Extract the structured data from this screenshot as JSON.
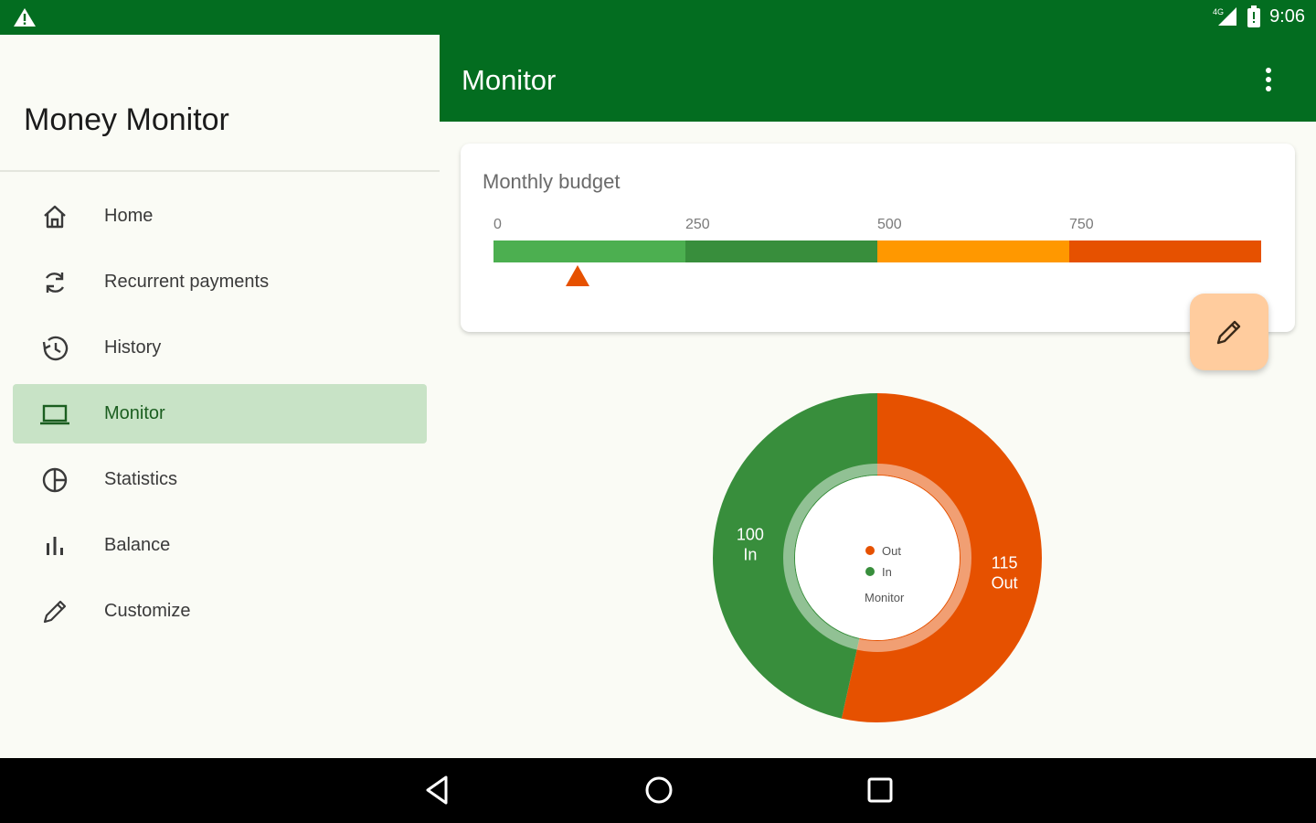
{
  "status_bar": {
    "network": "4G",
    "time": "9:06"
  },
  "drawer": {
    "title": "Money Monitor",
    "items": [
      {
        "label": "Home",
        "icon": "home-icon",
        "active": false
      },
      {
        "label": "Recurrent payments",
        "icon": "refresh-icon",
        "active": false
      },
      {
        "label": "History",
        "icon": "history-icon",
        "active": false
      },
      {
        "label": "Monitor",
        "icon": "laptop-icon",
        "active": true
      },
      {
        "label": "Statistics",
        "icon": "pie-chart-icon",
        "active": false
      },
      {
        "label": "Balance",
        "icon": "bar-chart-icon",
        "active": false
      },
      {
        "label": "Customize",
        "icon": "pencil-icon",
        "active": false
      }
    ]
  },
  "app_bar": {
    "title": "Monitor"
  },
  "budget": {
    "label": "Monthly budget",
    "ticks": [
      "0",
      "250",
      "500",
      "750"
    ],
    "scale_max": 1000,
    "segments": [
      {
        "from": 0,
        "to": 250,
        "color": "#4caf50"
      },
      {
        "from": 250,
        "to": 500,
        "color": "#388e3c"
      },
      {
        "from": 500,
        "to": 750,
        "color": "#ff9800"
      },
      {
        "from": 750,
        "to": 1000,
        "color": "#e65100"
      }
    ],
    "marker_value": 110,
    "marker_color": "#e65100"
  },
  "chart_data": {
    "type": "pie",
    "categories": [
      "Out",
      "In"
    ],
    "values": [
      115,
      100
    ],
    "colors": [
      "#e65100",
      "#388e3c"
    ],
    "slice_labels": [
      {
        "value": "115",
        "name": "Out"
      },
      {
        "value": "100",
        "name": "In"
      }
    ],
    "legend": [
      "Out",
      "In"
    ],
    "center_label": "Monitor",
    "legend_placement": "center"
  },
  "colors": {
    "primary": "#036d20",
    "accent": "#ffcc9e",
    "active_bg": "#c8e3c6"
  }
}
